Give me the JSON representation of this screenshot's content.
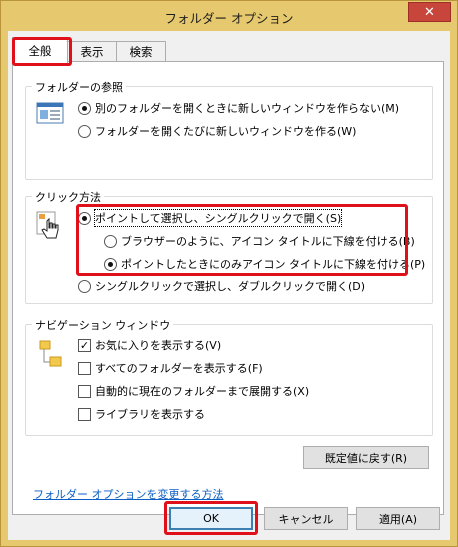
{
  "window": {
    "title": "フォルダー オプション",
    "close_glyph": "✕"
  },
  "tabs": [
    {
      "label": "全般"
    },
    {
      "label": "表示"
    },
    {
      "label": "検索"
    }
  ],
  "browse_folders": {
    "title": "フォルダーの参照",
    "options": [
      {
        "label": "別のフォルダーを開くときに新しいウィンドウを作らない(M)",
        "selected": true
      },
      {
        "label": "フォルダーを開くたびに新しいウィンドウを作る(W)",
        "selected": false
      }
    ]
  },
  "click_method": {
    "title": "クリック方法",
    "options": [
      {
        "label": "ポイントして選択し、シングルクリックで開く(S)",
        "selected": true
      },
      {
        "label": "ブラウザーのように、アイコン タイトルに下線を付ける(B)",
        "selected": false
      },
      {
        "label": "ポイントしたときにのみアイコン タイトルに下線を付ける(P)",
        "selected": true
      },
      {
        "label": "シングルクリックで選択し、ダブルクリックで開く(D)",
        "selected": false
      }
    ]
  },
  "navigation_pane": {
    "title": "ナビゲーション ウィンドウ",
    "options": [
      {
        "label": "お気に入りを表示する(V)",
        "checked": true
      },
      {
        "label": "すべてのフォルダーを表示する(F)",
        "checked": false
      },
      {
        "label": "自動的に現在のフォルダーまで展開する(X)",
        "checked": false
      },
      {
        "label": "ライブラリを表示する",
        "checked": false
      }
    ]
  },
  "restore_defaults_label": "既定値に戻す(R)",
  "help_link": "フォルダー オプションを変更する方法",
  "footer": {
    "ok_label": "OK",
    "cancel_label": "キャンセル",
    "apply_label": "適用(A)"
  },
  "icons": {
    "browse": "window-icon",
    "click": "hand-pointer-icon",
    "nav": "folder-tree-icon"
  },
  "colors": {
    "titlebar": "#e6c86e",
    "highlight": "#e0101a",
    "link": "#0b5fc4"
  }
}
